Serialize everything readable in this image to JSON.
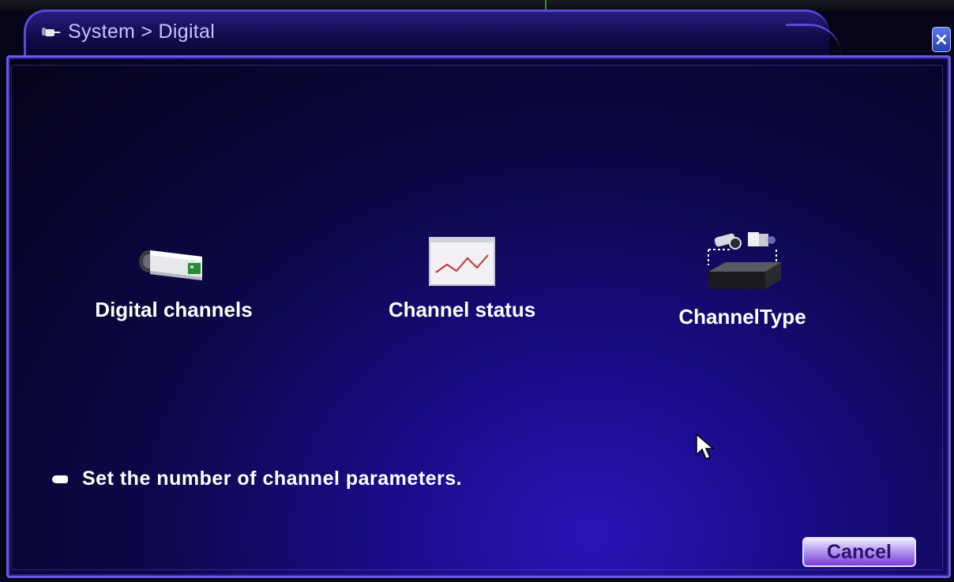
{
  "window": {
    "title": "System > Digital",
    "close_label": "×"
  },
  "menu": {
    "items": [
      {
        "label": "Digital channels",
        "icon": "camera-icon"
      },
      {
        "label": "Channel status",
        "icon": "status-chart-icon"
      },
      {
        "label": "ChannelType",
        "icon": "channel-type-icon"
      }
    ]
  },
  "hint": {
    "text": "Set the number of channel parameters."
  },
  "footer": {
    "cancel_label": "Cancel"
  },
  "colors": {
    "accent": "#6a5ae0",
    "title_text": "#c8c0ff",
    "panel_bg": "#1a0c88"
  }
}
